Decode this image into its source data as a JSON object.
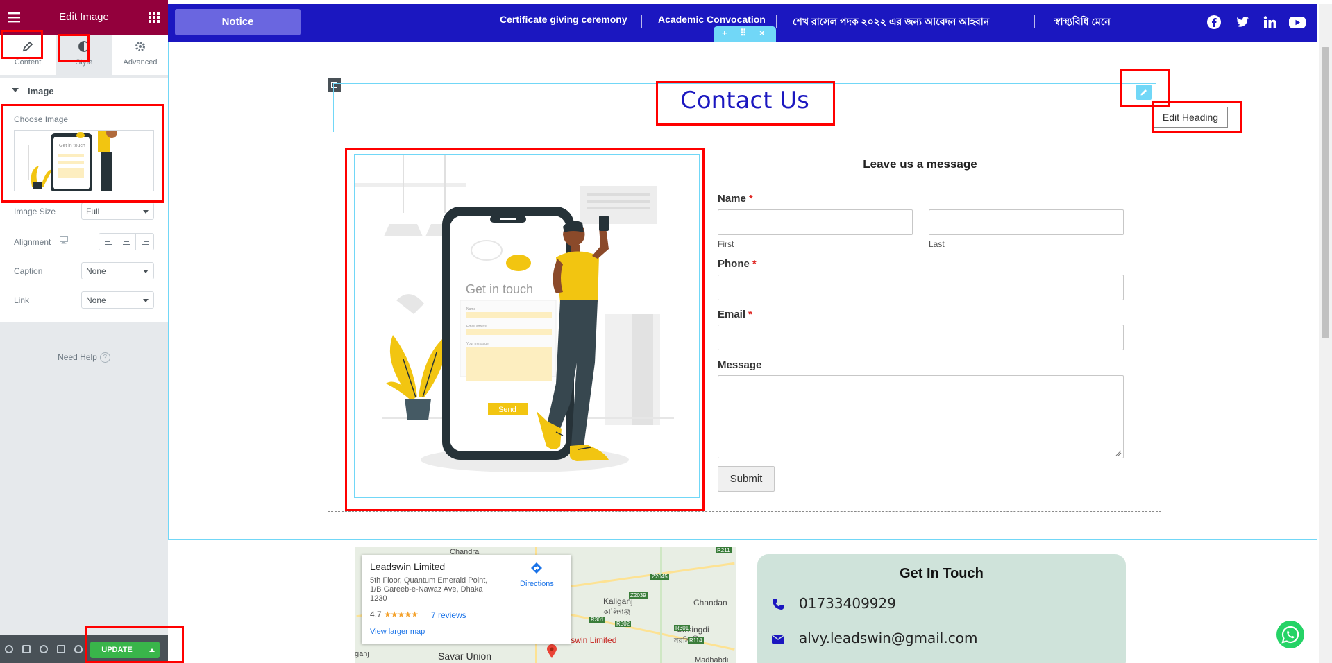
{
  "panel": {
    "title": "Edit Image",
    "tabs": [
      {
        "label": "Content",
        "icon": "pencil-icon"
      },
      {
        "label": "Style",
        "icon": "half-circle-icon"
      },
      {
        "label": "Advanced",
        "icon": "gear-icon"
      }
    ],
    "section_title": "Image",
    "choose_image_label": "Choose Image",
    "image_size": {
      "label": "Image Size",
      "value": "Full"
    },
    "alignment": {
      "label": "Alignment",
      "icon": "desktop-icon"
    },
    "caption": {
      "label": "Caption",
      "value": "None"
    },
    "link": {
      "label": "Link",
      "value": "None"
    },
    "need_help": "Need Help",
    "help_icon": "?",
    "footer": {
      "icons": [
        "settings-icon",
        "navigator-icon",
        "history-icon",
        "responsive-icon",
        "preview-eye-icon"
      ],
      "update_label": "UPDATE"
    },
    "accent_color": "#93003c"
  },
  "topbar": {
    "notice_label": "Notice",
    "ticker": [
      "Certificate giving ceremony",
      "Academic Convocation",
      "শেখ রাসেল পদক ২০২২ এর জন্য আবেদন আহবান",
      "স্বাস্থ্যবিধি মেনে"
    ],
    "social_icons": [
      "facebook-icon",
      "twitter-icon",
      "linkedin-icon",
      "youtube-icon"
    ],
    "background_color": "#1b17c0"
  },
  "section_handle": {
    "add": "+",
    "move": "⠿",
    "close": "×"
  },
  "heading": {
    "text": "Contact Us",
    "edit_tooltip": "Edit Heading",
    "color": "#1b17c0"
  },
  "image_widget": {
    "illustration_title": "Get in touch",
    "fields": [
      "Name",
      "Email adress",
      "Your message"
    ],
    "send_label": "Send"
  },
  "form": {
    "title": "Leave us a message",
    "name_label": "Name",
    "first_label": "First",
    "last_label": "Last",
    "phone_label": "Phone",
    "email_label": "Email",
    "message_label": "Message",
    "required_mark": "*",
    "submit_label": "Submit"
  },
  "map": {
    "place_name": "Leadswin Limited",
    "address": "5th Floor, Quantum Emerald Point, 1/B Gareeb-e-Nawaz Ave, Dhaka 1230",
    "rating": "4.7",
    "stars": "★★★★★",
    "reviews": "7 reviews",
    "directions": "Directions",
    "view_larger": "View larger map",
    "labels": {
      "chandra": "Chandra",
      "kaliganj": "Kaliganj",
      "kaliganj_bn": "কালিগঞ্জ",
      "chandan": "Chandan",
      "narsingdi": "Narsingdi",
      "narsingdi_bn": "নরসিংদী",
      "savar_union": "Savar Union",
      "ganj": "ganj",
      "madhabdi": "Madhabdi",
      "leadswin_pin": "adswin Limited",
      "r211": "R211",
      "z2045": "Z2045",
      "z2039": "Z2039",
      "r301a": "R301",
      "r302": "R302",
      "r301b": "R301",
      "r114": "R114"
    }
  },
  "get_in_touch": {
    "title": "Get In Touch",
    "phone": "01733409929",
    "email": "alvy.leadswin@gmail.com"
  }
}
